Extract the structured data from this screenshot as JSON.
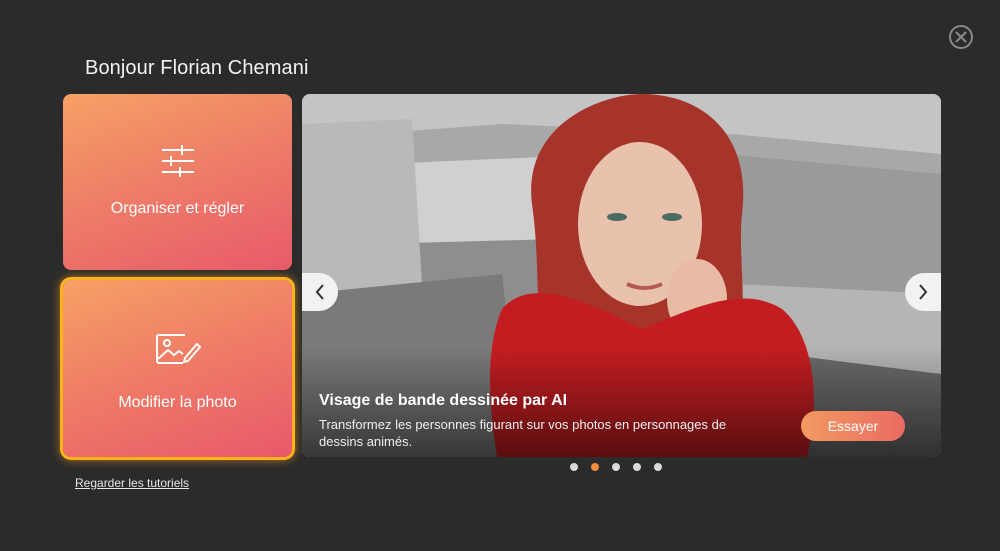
{
  "greeting": "Bonjour Florian Chemani",
  "cards": {
    "organize": {
      "label": "Organiser et régler",
      "icon": "sliders-icon"
    },
    "edit": {
      "label": "Modifier la photo",
      "icon": "photo-edit-icon"
    }
  },
  "tutorial_link": "Regarder les tutoriels",
  "banner": {
    "title": "Visage de bande dessinée par AI",
    "description": "Transformez les personnes figurant sur vos photos en personnages de dessins animés.",
    "button": "Essayer"
  },
  "carousel": {
    "slide_count": 5,
    "active_index": 1
  },
  "colors": {
    "accent": "#f08a3c",
    "highlight": "#ffb21e",
    "card_gradient_start": "#f6a165",
    "card_gradient_end": "#e85a6a"
  }
}
